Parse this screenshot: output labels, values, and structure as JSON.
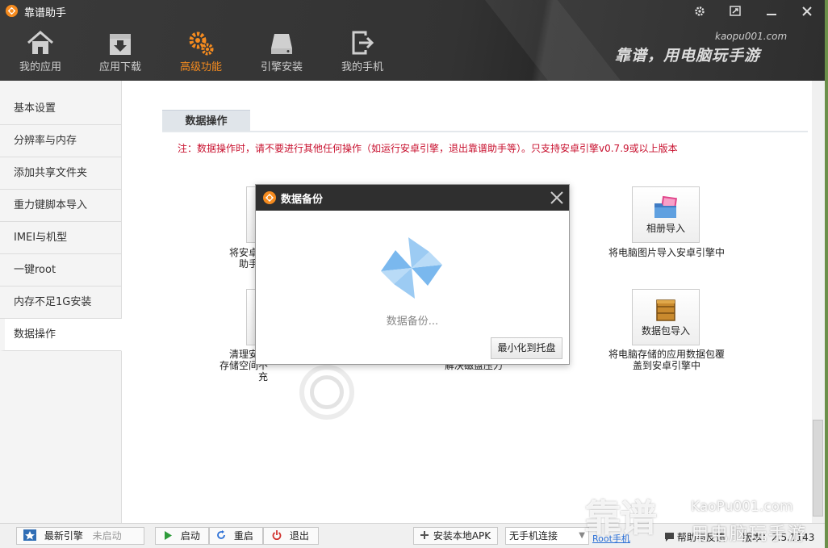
{
  "window": {
    "title": "靠谱助手",
    "settings_icon": "gear-icon",
    "minimize_to_mini_icon": "restore-icon",
    "minimize_icon": "minimize-icon",
    "close_icon": "close-icon"
  },
  "header": {
    "nav": [
      {
        "label": "我的应用",
        "icon": "home-icon"
      },
      {
        "label": "应用下载",
        "icon": "download-icon"
      },
      {
        "label": "高级功能",
        "icon": "gears-icon",
        "active": true
      },
      {
        "label": "引擎安装",
        "icon": "disk-icon"
      },
      {
        "label": "我的手机",
        "icon": "export-icon"
      }
    ],
    "site": "kaopu001.com",
    "slogan": "靠谱，用电脑玩手游"
  },
  "sidebar": {
    "items": [
      {
        "label": "基本设置"
      },
      {
        "label": "分辨率与内存"
      },
      {
        "label": "添加共享文件夹"
      },
      {
        "label": "重力键脚本导入"
      },
      {
        "label": "IMEI与机型"
      },
      {
        "label": "一键root"
      },
      {
        "label": "内存不足1G安装"
      },
      {
        "label": "数据操作",
        "active": true
      }
    ]
  },
  "main": {
    "section_tab": "数据操作",
    "notice": "注：数据操作时，请不要进行其他任何操作（如运行安卓引擎，退出靠谱助手等）。只支持安卓引擎v0.7.9或以上版本",
    "tiles": [
      {
        "label": "相册导入",
        "desc_line1": "将电脑图片导入安卓引擎中",
        "desc_line2": ""
      },
      {
        "label": "数据包导入",
        "desc_line1": "将电脑存储的应用数据包覆",
        "desc_line2": "盖到安卓引擎中"
      }
    ],
    "partial_left_desc1_a": "将安卓引",
    "partial_left_desc1_b": "助手目",
    "partial_left_desc2_a": "清理安卓",
    "partial_left_desc2_b": "存储空间不充",
    "partial_mid_desc2": "解决磁盘压力"
  },
  "dialog": {
    "title": "数据备份",
    "status": "数据备份...",
    "minimize_button": "最小化到托盘"
  },
  "statusbar": {
    "engine_label": "最新引擎",
    "engine_state": "未启动",
    "start": "启动",
    "restart": "重启",
    "exit": "退出",
    "install_apk": "安装本地APK",
    "phone_select": "无手机连接",
    "root_link": "Root手机",
    "help": "帮助与反馈",
    "version": "版本：2.5.1143"
  },
  "watermark": {
    "big": "靠谱",
    "site": "KaoPu001.com",
    "sub": "用电脑玩手游"
  },
  "colors": {
    "header_bg": "#333333",
    "accent_orange": "#f58b1f",
    "notice_red": "#c8102e",
    "dialog_header": "#2f2f2f",
    "pinwheel_blue": "#7ab8ee"
  }
}
